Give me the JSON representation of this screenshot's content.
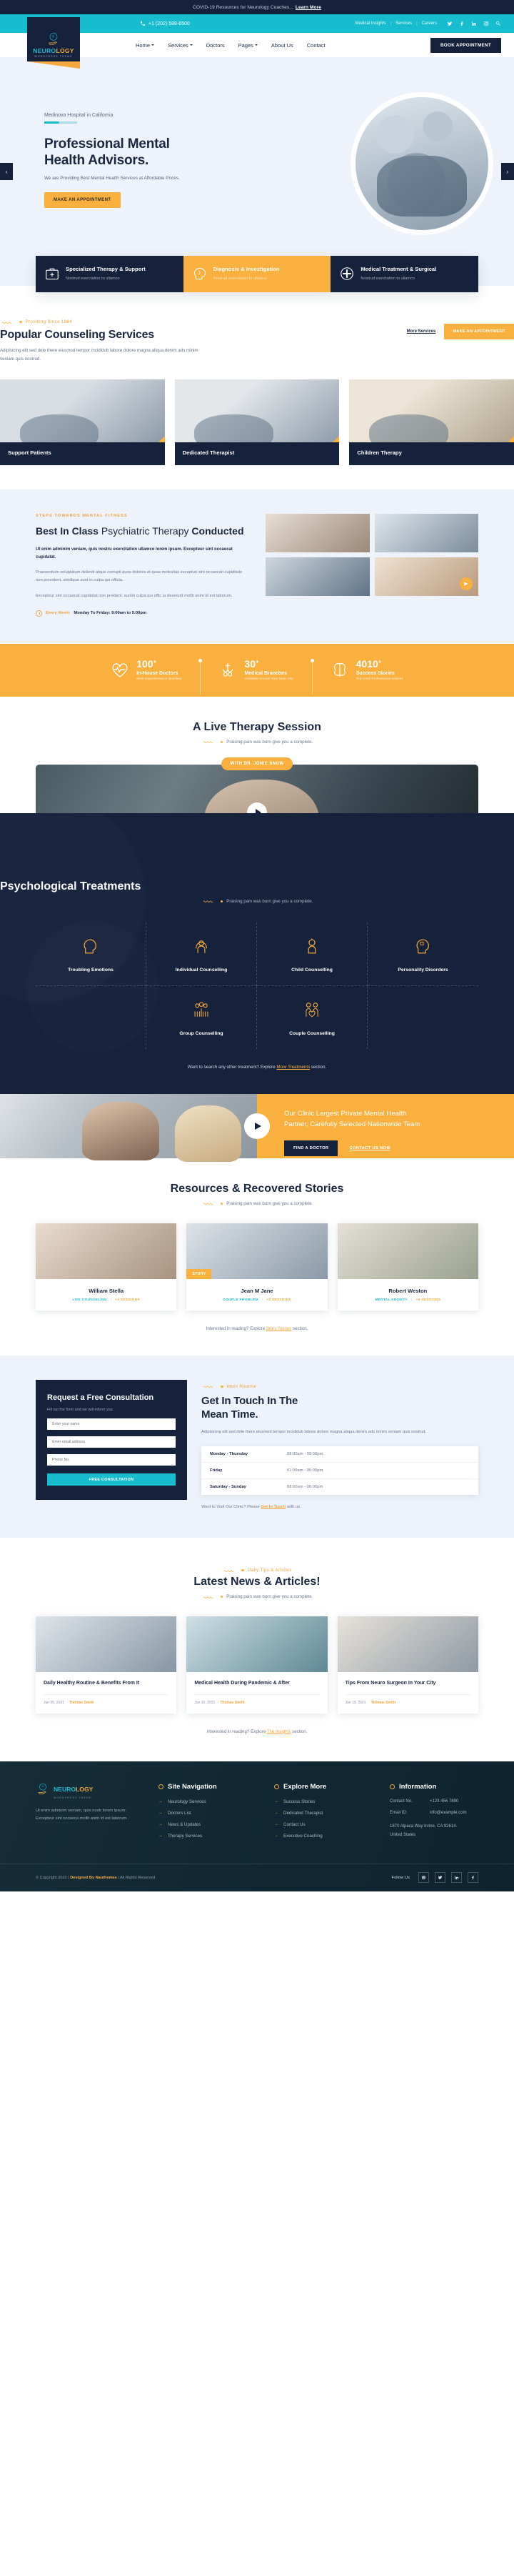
{
  "topbar": {
    "notice": "COVID-19 Resources for Neurology Coaches...",
    "notice_link": "Learn More"
  },
  "utilitybar": {
    "phone": "+1 (202) 588-6500",
    "links": [
      "Medical Insights",
      "Services",
      "Careers"
    ],
    "socials": [
      "twitter-icon",
      "facebook-icon",
      "linkedin-icon",
      "instagram-icon",
      "search-icon"
    ]
  },
  "brand": {
    "name_part1": "NEURO",
    "name_part2": "LOGY",
    "tagline": "WORDPRESS THEME"
  },
  "nav": {
    "items": [
      {
        "label": "Home",
        "caret": true
      },
      {
        "label": "Services",
        "caret": true
      },
      {
        "label": "Doctors",
        "caret": false
      },
      {
        "label": "Pages",
        "caret": true
      },
      {
        "label": "About Us",
        "caret": false
      },
      {
        "label": "Contact",
        "caret": false
      }
    ],
    "cta": "BOOK APPOINTMENT"
  },
  "hero": {
    "eyebrow": "Medinova Hospital in California",
    "title_line1": "Professional Mental",
    "title_line2": "Health Advisors.",
    "subtitle": "We are Providing Best Mental Health Services at Affordable Prices.",
    "cta": "MAKE AN APPOINTMENT",
    "prev": "‹",
    "next": "›"
  },
  "features": [
    {
      "icon": "medical-kit-icon",
      "title": "Specialized Therapy & Support",
      "desc": "Nostrud exerctation to ullamco",
      "style": "dark"
    },
    {
      "icon": "head-brain-icon",
      "title": "Diagnosis & Investigation",
      "desc": "Nostrud exerctation to ullamco",
      "style": "amber"
    },
    {
      "icon": "medical-cross-icon",
      "title": "Medical Treatment & Surgical",
      "desc": "Nostrud exerctation to ullamco",
      "style": "dark"
    }
  ],
  "services": {
    "tag": "Providing Since 1984",
    "title": "Popular Counseling Services",
    "lead": "Adipisicing elit sed dole there eiusmod tempor incididub labore dolore magna aliqua denim ads minim veniam quis nostrud.",
    "more_link": "More Services",
    "cta": "MAKE AN APPOINTMENT",
    "cards": [
      {
        "label": "Support Patients"
      },
      {
        "label": "Dedicated Therapist"
      },
      {
        "label": "Children Therapy"
      }
    ]
  },
  "bestinclass": {
    "kicker": "STEPS TOWARDS MENTAL FITNESS",
    "title_a": "Best In Class",
    "title_b": " Psychiatric Therapy ",
    "title_c": "Conducted",
    "bold": "Ut enim adminim veniam, quis nostru exercitation ullamco lorem ipsum. Excepteur sint occaecat cupidatat.",
    "para1": "Praesentium voluptatum deleniti atque corrupti quos dolores et quas molestias excepturi sint occaecati cupiditate non provident, similique sunt in culpa qui officia.",
    "para2": "Excepteur sint occaecat cupidatat non proident, suntin culpa qui offic ia deserunt mollit anim id est laborum.",
    "hours_label": "Every Week:",
    "hours_value": "Monday To Friday: 9:00am to 5:00pm"
  },
  "stats": [
    {
      "icon": "heartbeat-icon",
      "number": "100",
      "plus": "+",
      "label": "In-House Doctors",
      "sub": "Most Experienced & Qualified"
    },
    {
      "icon": "medical-branch-icon",
      "number": "30",
      "plus": "+",
      "label": "Medical Branches",
      "sub": "Available Around Your Near City"
    },
    {
      "icon": "brain-icon",
      "number": "4010",
      "plus": "+",
      "label": "Success Stories",
      "sub": "Top Level Professional Advices"
    }
  ],
  "live": {
    "title": "A Live Therapy Session",
    "subtitle": "Praising pain was born give you a complete.",
    "badge": "WITH DR. JONIE SNOW"
  },
  "treatments": {
    "title": "Psychological Treatments",
    "subtitle": "Praising pain was born give you a complete.",
    "items": [
      {
        "icon": "head-profile-icon",
        "label": "Troubling Emotions"
      },
      {
        "icon": "individual-counselling-icon",
        "label": "Individual Counselling"
      },
      {
        "icon": "child-icon",
        "label": "Child Counselling"
      },
      {
        "icon": "head-puzzle-icon",
        "label": "Personality Disorders"
      },
      {
        "icon": "group-people-icon",
        "label": "Group Counselling"
      },
      {
        "icon": "couple-heart-icon",
        "label": "Couple Counselling"
      }
    ],
    "footer_pre": "Want to search any other treatment? Explore ",
    "footer_link": "More Treatments",
    "footer_post": " section."
  },
  "promo": {
    "title_line1": "Our Clinic Largest Private Mental Health",
    "title_line2": "Partner, Carefully Selected Nationwide Team",
    "btn_primary": "FIND A DOCTOR",
    "btn_secondary": "CONTACT US NOW"
  },
  "resources": {
    "title": "Resources & Recovered Stories",
    "subtitle": "Praising pain was born give you a complete.",
    "cards": [
      {
        "badge": "",
        "name": "William Stella",
        "tag1": "LIFE COUNSELING",
        "tag2": "+2 SESSIONS"
      },
      {
        "badge": "STORY",
        "name": "Jean M Jane",
        "tag1": "COUPLE PROBLEM",
        "tag2": "+3 SESSIONS"
      },
      {
        "badge": "",
        "name": "Robert Weston",
        "tag1": "MENTAL ANXIETY",
        "tag2": "+5 SESSIONS"
      }
    ],
    "footer_pre": "Interested in reading? Explore ",
    "footer_link": "Story Stories",
    "footer_post": " section."
  },
  "consultation": {
    "form_title": "Request a Free Consultation",
    "form_sub": "Fill out the form and we will inform you.",
    "fields": [
      {
        "placeholder": "Enter your name"
      },
      {
        "placeholder": "Enter email address"
      },
      {
        "placeholder": "Phone No."
      }
    ],
    "submit": "FREE CONSULTATION",
    "tag": "Work Routine",
    "title_a": "Get In Touch In The",
    "title_b": "Mean Time.",
    "para": "Adipisicing elit sed dole there eiusmod tempor incididub labore dolore magna aliqua denim ads minim veniam quis nostrud.",
    "hours": [
      {
        "day": "Monday - Thursday",
        "time": "08:00am - 09:00pm"
      },
      {
        "day": "Friday",
        "time": "01:00am - 05:00pm"
      },
      {
        "day": "Saturday - Sunday",
        "time": "08:00am - 06:00pm"
      }
    ],
    "visit_pre": "Want to Visit Our Clinic? Please ",
    "visit_link": "Get In Touch",
    "visit_post": " with us."
  },
  "news": {
    "tag": "Daily Tips & Articles",
    "title": "Latest News & Articles!",
    "subtitle": "Praising pain was born give you a complete.",
    "cards": [
      {
        "title": "Daily Healthy Routine & Benefits From It",
        "date": "Jun 05, 2021",
        "author": "Thomas Smith"
      },
      {
        "title": "Medical Health During Pandemic & After",
        "date": "Jun 10, 2021",
        "author": "Thomas Smith"
      },
      {
        "title": "Tips From Neuro Surgeon In Your City",
        "date": "Jun 19, 2021",
        "author": "Thomas Smith"
      }
    ],
    "footer_pre": "Interested in reading? Explore ",
    "footer_link": "The Insights",
    "footer_post": " section."
  },
  "footer": {
    "about": "Ut enim adminim veniam, quis nostr lorem ipsum. Excepteur sint occaeca mollit anim id est laborum.",
    "col_nav_title": "Site Navigation",
    "col_nav": [
      "Neurology Services",
      "Doctors List",
      "News & Updates",
      "Therapy Services"
    ],
    "col_explore_title": "Explore More",
    "col_explore": [
      "Success Stories",
      "Dedicated Therapist",
      "Contact Us",
      "Executive Coaching"
    ],
    "col_info_title": "Information",
    "contact_label": "Contact No.",
    "contact_value": "+123 456 7890",
    "email_label": "Email ID:",
    "email_value": "info@example.com",
    "address_line1": "1870 Alpaca Way Irvine, CA 92614.",
    "address_line2": "United States",
    "copyright_pre": "© Copyright 2022 | ",
    "copyright_brand": "Designed By Nauthemes",
    "copyright_post": " | All Rights Reserved",
    "follow_label": "Follow Us",
    "socials": [
      "instagram-icon",
      "twitter-icon",
      "linkedin-icon",
      "facebook-icon"
    ]
  },
  "colors": {
    "navy": "#16213c",
    "teal": "#17bccf",
    "amber": "#f9b03f",
    "light": "#eef2fa",
    "footer": "#0f2430"
  }
}
